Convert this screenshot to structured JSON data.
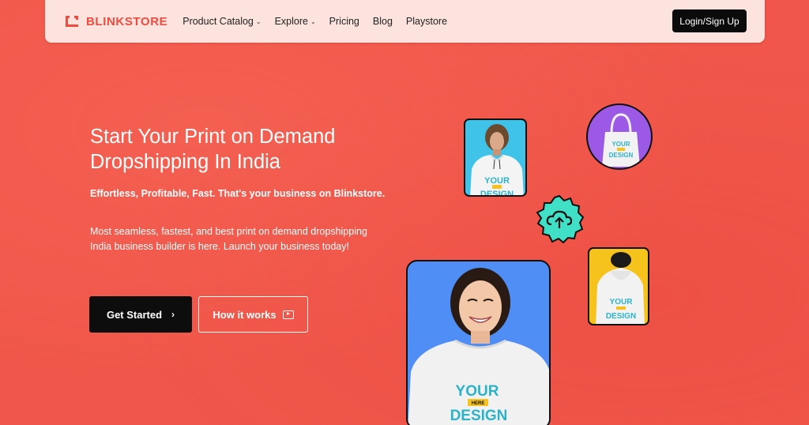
{
  "brand": {
    "name": "BLINKSTORE",
    "accent": "#ef4b3f"
  },
  "nav": {
    "items": [
      {
        "label": "Product Catalog",
        "has_dropdown": true
      },
      {
        "label": "Explore",
        "has_dropdown": true
      },
      {
        "label": "Pricing",
        "has_dropdown": false
      },
      {
        "label": "Blog",
        "has_dropdown": false
      },
      {
        "label": "Playstore",
        "has_dropdown": false
      }
    ],
    "login_label": "Login/Sign Up",
    "chevron_icon": "chevron-down-icon"
  },
  "hero": {
    "title_line1": "Start Your Print on Demand",
    "title_line2": "Dropshipping In India",
    "subtitle": "Effortless, Profitable, Fast. That's your business on Blinkstore.",
    "description": "Most seamless, fastest, and best print on demand dropshipping India business builder is here. Launch your business today!",
    "primary_button": "Get Started",
    "primary_icon": "chevron-right-icon",
    "secondary_button": "How it works",
    "secondary_icon": "play-icon",
    "background_color": "#f0574a"
  },
  "gallery": {
    "print_lines": [
      "YOUR",
      "HERE",
      "DESIGN"
    ],
    "upload_icon": "cloud-upload-icon",
    "colors": {
      "hoodie_card": "#3fc3e8",
      "bag_card": "#9b59e6",
      "back_card": "#f6c21c",
      "woman_card": "#4f8ff5",
      "upload_badge": "#3fe0c5"
    }
  }
}
